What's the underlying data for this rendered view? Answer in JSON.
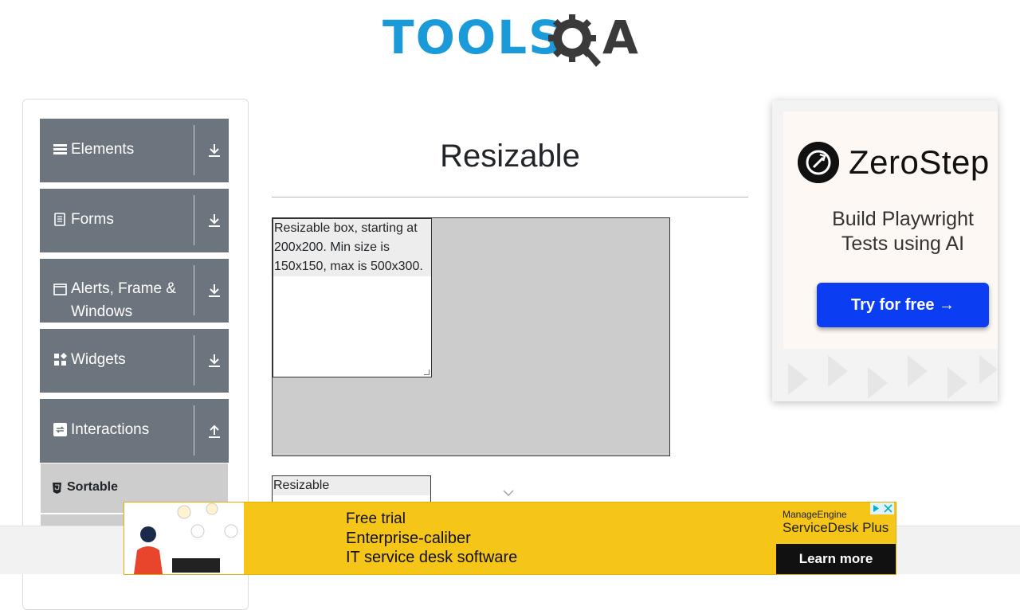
{
  "header": {
    "logo_text_left": "TOOLS",
    "logo_text_right": "A"
  },
  "sidebar": {
    "groups": [
      {
        "label": "Elements",
        "icon": "hamburger-icon",
        "arrow": "download-icon"
      },
      {
        "label": "Forms",
        "icon": "document-icon",
        "arrow": "download-icon"
      },
      {
        "label": "Alerts, Frame & Windows",
        "icon": "window-icon",
        "arrow": "download-icon"
      },
      {
        "label": "Widgets",
        "icon": "widgets-icon",
        "arrow": "download-icon"
      },
      {
        "label": "Interactions",
        "icon": "interactions-icon",
        "arrow": "upload-icon"
      }
    ],
    "subitems": [
      {
        "label": "Sortable",
        "icon": "html5-icon"
      }
    ]
  },
  "main": {
    "title": "Resizable",
    "box1_text": "Resizable box, starting at 200x200. Min size is 150x150, max is 500x300.",
    "box2_text": "Resizable"
  },
  "ad_right": {
    "brand": "ZeroStep",
    "tagline": "Build Playwright Tests using AI",
    "cta": "Try for free →"
  },
  "ad_bottom": {
    "line1": "Free trial",
    "line2": "Enterprise-caliber",
    "line3": "IT service desk software",
    "brand": "ManageEngine",
    "product": "ServiceDesk Plus",
    "cta": "Learn more"
  },
  "colors": {
    "sidebar_group_bg": "#6c757d",
    "sidebar_subitem_bg": "#cdcdcd",
    "logo_blue": "#1a9ad9",
    "logo_dark": "#3a3a3a",
    "ad_bottom_bg": "#f5c518",
    "zerostep_button": "#0b3df2"
  }
}
